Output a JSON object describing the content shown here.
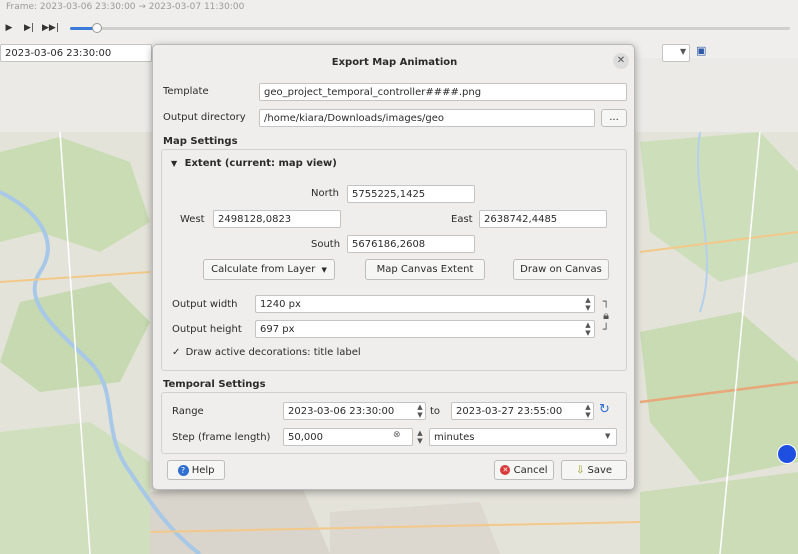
{
  "background": {
    "range_text": "Frame: 2023-03-06 23:30:00 → 2023-03-07 11:30:00",
    "start_field": "2023-03-06 23:30:00",
    "end_field": "",
    "save_icon": "floppy-save-icon"
  },
  "dialog": {
    "title": "Export Map Animation",
    "template_label": "Template",
    "template_value": "geo_project_temporal_controller####.png",
    "output_dir_label": "Output directory",
    "output_dir_value": "/home/kiara/Downloads/images/geo",
    "browse_label": "...",
    "map_settings_label": "Map Settings",
    "extent_label": "Extent (current: map view)",
    "north_label": "North",
    "north_value": "5755225,1425",
    "west_label": "West",
    "west_value": "2498128,0823",
    "east_label": "East",
    "east_value": "2638742,4485",
    "south_label": "South",
    "south_value": "5676186,2608",
    "calc_from_layer": "Calculate from Layer",
    "map_canvas_extent": "Map Canvas Extent",
    "draw_on_canvas": "Draw on Canvas",
    "output_width_label": "Output width",
    "output_width_value": "1240 px",
    "output_height_label": "Output height",
    "output_height_value": "697 px",
    "draw_decorations_label": "Draw active decorations: title label",
    "draw_decorations_checked": true,
    "temporal_settings_label": "Temporal Settings",
    "range_label": "Range",
    "range_start": "2023-03-06 23:30:00",
    "range_to": "to",
    "range_end": "2023-03-27 23:55:00",
    "step_label": "Step (frame length)",
    "step_value": "50,000",
    "step_unit": "minutes",
    "help_label": "Help",
    "cancel_label": "Cancel",
    "save_label": "Save"
  }
}
